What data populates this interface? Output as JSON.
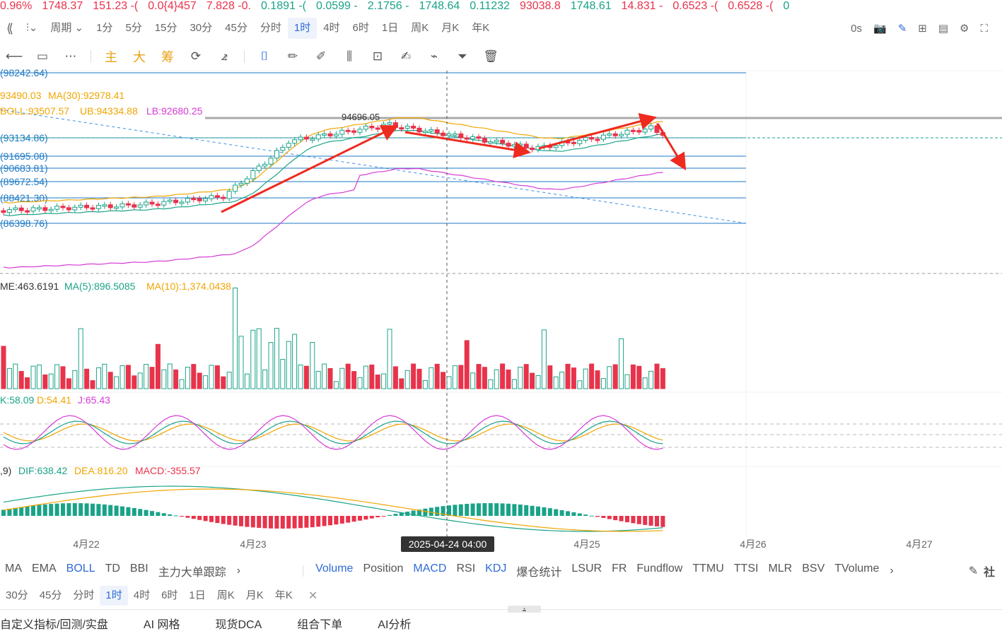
{
  "ticker": [
    {
      "v": "0.96%",
      "c": "dn"
    },
    {
      "v": "1748.37",
      "c": "dn"
    },
    {
      "v": "151.23 -(",
      "c": "dn"
    },
    {
      "v": "0.0{4}457",
      "c": "dn"
    },
    {
      "v": "7.828 -0.",
      "c": "dn"
    },
    {
      "v": "0.1891 -(",
      "c": "up"
    },
    {
      "v": "0.0599 -",
      "c": "up"
    },
    {
      "v": "2.1756 -",
      "c": "up"
    },
    {
      "v": "1748.64",
      "c": "up"
    },
    {
      "v": "0.11232",
      "c": "up"
    },
    {
      "v": "93038.8",
      "c": "dn"
    },
    {
      "v": "1748.61",
      "c": "up"
    },
    {
      "v": "14.831 -",
      "c": "dn"
    },
    {
      "v": "0.6523 -(",
      "c": "dn"
    },
    {
      "v": "0.6528 -(",
      "c": "dn"
    },
    {
      "v": "0",
      "c": "up"
    }
  ],
  "toolbar": {
    "periods": [
      "周期",
      "1分",
      "5分",
      "15分",
      "30分",
      "45分",
      "分时",
      "1时",
      "4时",
      "6时",
      "1日",
      "周K",
      "月K",
      "年K"
    ],
    "active_period": "1时",
    "timer": "0s"
  },
  "draw_tools": {
    "hl": [
      "主",
      "大",
      "筹"
    ]
  },
  "main_chart": {
    "price_levels": [
      "(98242.64)",
      "(93134.86)",
      "(91695.08)",
      "(90683.81)",
      "(89672.54)",
      "(88421.30)",
      "(86398.76)"
    ],
    "ma_label": {
      "prefix": "93490.03",
      "ma30": "MA(30):92978.41"
    },
    "boll_label": {
      "mid": "BOLL:93507.57",
      "ub": "UB:94334.88",
      "lb": "LB:92680.25"
    },
    "high_label": "94696.05",
    "crosshair_time": "2025-04-24 04:00",
    "x_labels": [
      "4月22",
      "4月23",
      "4月25",
      "4月26",
      "4月27"
    ]
  },
  "volume_panel": {
    "label": "ME:463.6191",
    "ma5": "MA(5):896.5085",
    "ma10": "MA(10):1,374.0438"
  },
  "kdj_panel": {
    "k": "K:58.09",
    "d": "D:54.41",
    "j": "J:65.43"
  },
  "macd_panel": {
    "params": ",9)",
    "dif": "DIF:638.42",
    "dea": "DEA:816.20",
    "macd": "MACD:-355.57"
  },
  "indicator_tabs": {
    "main": [
      "MA",
      "EMA",
      "BOLL",
      "TD",
      "BBI",
      "主力大单跟踪"
    ],
    "main_active": "BOLL",
    "sub": [
      "Volume",
      "Position",
      "MACD",
      "RSI",
      "KDJ",
      "爆仓统计",
      "LSUR",
      "FR",
      "Fundflow",
      "TTMU",
      "TTSI",
      "MLR",
      "BSV",
      "TVolume"
    ],
    "sub_active": [
      "Volume",
      "MACD",
      "KDJ"
    ],
    "right": "社"
  },
  "period_bar2": {
    "items": [
      "30分",
      "45分",
      "分时",
      "1时",
      "4时",
      "6时",
      "1日",
      "周K",
      "月K",
      "年K"
    ],
    "active": "1时"
  },
  "bottom_bar": {
    "items": [
      "自定义指标/回测/实盘",
      "AI 网格",
      "现货DCA",
      "组合下单",
      "AI分析"
    ]
  },
  "colors": {
    "up": "#1aa388",
    "down": "#e8334b",
    "accent": "#2f6bd7",
    "ma": "#f0a500",
    "boll_lb": "#d63ad6",
    "level_line": "#1f7ac4",
    "arrow": "#ef2a1f"
  }
}
